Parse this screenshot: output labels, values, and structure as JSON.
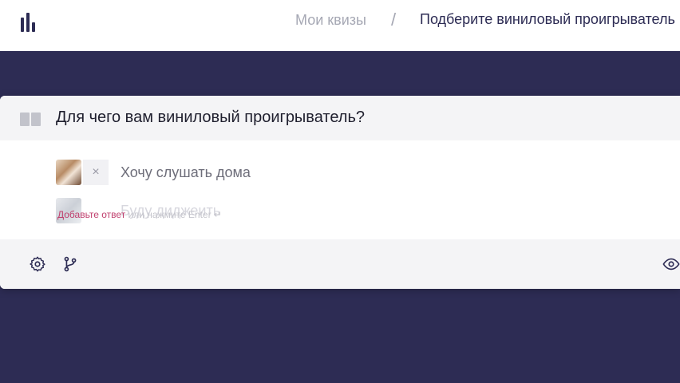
{
  "breadcrumb": {
    "my_quizzes": "Мои квизы",
    "separator": "/",
    "current": "Подберите виниловый проигрыватель"
  },
  "card": {
    "question": "Для чего вам виниловый проигрыватель?",
    "answers": [
      {
        "label": "Хочу слушать дома",
        "remove": "×"
      },
      {
        "label": "Буду диджеить"
      }
    ],
    "add_hint": {
      "link": "Добавьте ответ",
      "rest": " или нажмите Enter ↵"
    }
  },
  "icons": {
    "logo": "bar-chart-logo",
    "drag": "drag-handle-icon",
    "settings": "gear-icon",
    "branch": "branch-icon",
    "preview": "eye-icon"
  },
  "colors": {
    "accent": "#2d2c54",
    "link": "#c0406e"
  }
}
